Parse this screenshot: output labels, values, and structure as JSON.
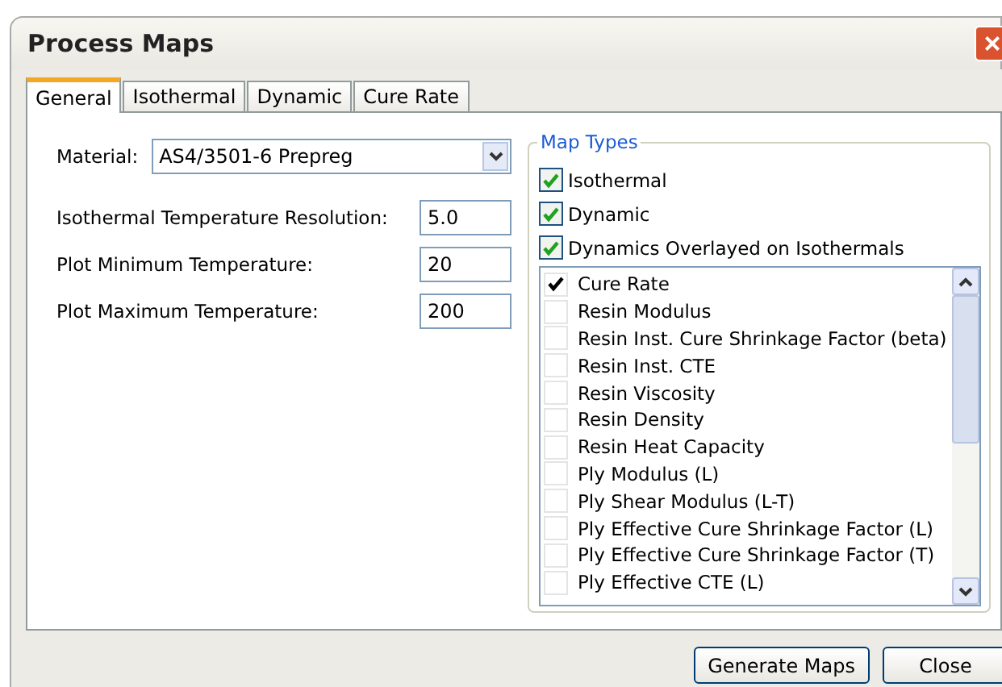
{
  "window": {
    "title": "Process Maps",
    "close": "×"
  },
  "tabs": [
    {
      "label": "General",
      "selected": true
    },
    {
      "label": "Isothermal",
      "selected": false
    },
    {
      "label": "Dynamic",
      "selected": false
    },
    {
      "label": "Cure Rate",
      "selected": false
    }
  ],
  "material": {
    "label": "Material:",
    "value": "AS4/3501-6 Prepreg"
  },
  "fields": [
    {
      "label": "Isothermal Temperature Resolution:",
      "value": "5.0"
    },
    {
      "label": "Plot Minimum Temperature:",
      "value": "20"
    },
    {
      "label": "Plot Maximum Temperature:",
      "value": "200"
    }
  ],
  "map_types": {
    "title": "Map Types",
    "options": [
      {
        "label": "Isothermal",
        "checked": true
      },
      {
        "label": "Dynamic",
        "checked": true
      },
      {
        "label": "Dynamics Overlayed on Isothermals",
        "checked": true
      }
    ],
    "list": [
      {
        "label": "Cure Rate",
        "checked": true
      },
      {
        "label": "Resin Modulus",
        "checked": false
      },
      {
        "label": "Resin Inst. Cure Shrinkage Factor (beta)",
        "checked": false
      },
      {
        "label": "Resin Inst. CTE",
        "checked": false
      },
      {
        "label": "Resin Viscosity",
        "checked": false
      },
      {
        "label": "Resin Density",
        "checked": false
      },
      {
        "label": "Resin Heat Capacity",
        "checked": false
      },
      {
        "label": "Ply Modulus (L)",
        "checked": false
      },
      {
        "label": "Ply Shear Modulus (L-T)",
        "checked": false
      },
      {
        "label": "Ply Effective Cure Shrinkage Factor (L)",
        "checked": false
      },
      {
        "label": "Ply Effective Cure Shrinkage Factor (T)",
        "checked": false
      },
      {
        "label": "Ply Effective CTE (L)",
        "checked": false
      }
    ]
  },
  "buttons": [
    "Generate Maps",
    "Close"
  ]
}
